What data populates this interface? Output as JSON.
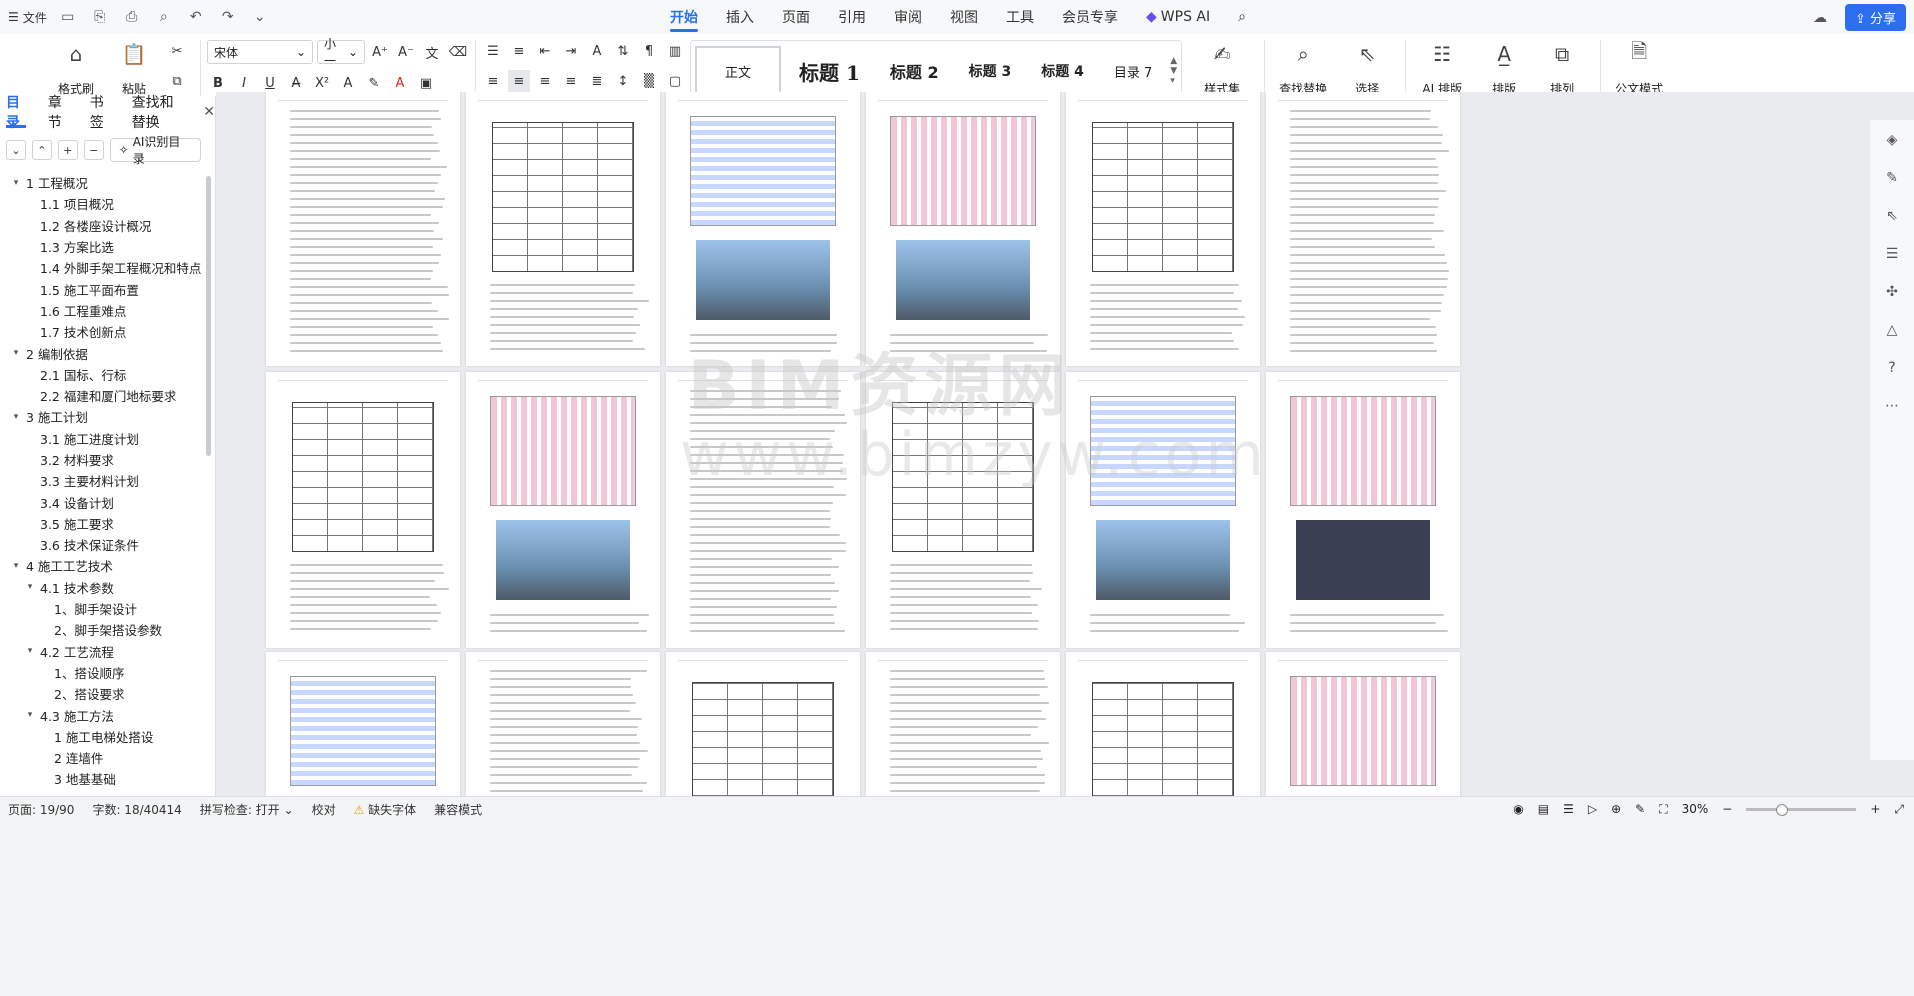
{
  "titlebar": {
    "file_menu": "文件",
    "tabs": [
      "开始",
      "插入",
      "页面",
      "引用",
      "审阅",
      "视图",
      "工具",
      "会员专享",
      "WPS AI"
    ],
    "share": "分享"
  },
  "ribbon": {
    "format_brush": "格式刷",
    "paste": "粘贴",
    "font_name": "宋体",
    "font_size": "小一",
    "styles": [
      "正文",
      "标题 1",
      "标题 2",
      "标题 3",
      "标题 4",
      "目录 7"
    ],
    "style_set": "样式集",
    "find_replace": "查找替换",
    "select": "选择",
    "ai_layout": "AI 排版",
    "layout": "排版",
    "arrange": "排列",
    "formula_mode": "公文模式"
  },
  "sidepanel": {
    "tabs": [
      "目录",
      "章节",
      "书签",
      "查找和替换"
    ],
    "ai_toc": "AI识别目录",
    "toc": [
      {
        "level": 0,
        "text": "1  工程概况",
        "collapsible": true
      },
      {
        "level": 1,
        "text": "1.1 项目概况"
      },
      {
        "level": 1,
        "text": "1.2 各楼座设计概况"
      },
      {
        "level": 1,
        "text": "1.3 方案比选"
      },
      {
        "level": 1,
        "text": "1.4 外脚手架工程概况和特点"
      },
      {
        "level": 1,
        "text": "1.5 施工平面布置"
      },
      {
        "level": 1,
        "text": "1.6 工程重难点"
      },
      {
        "level": 1,
        "text": "1.7 技术创新点"
      },
      {
        "level": 0,
        "text": "2  编制依据",
        "collapsible": true
      },
      {
        "level": 1,
        "text": "2.1 国标、行标"
      },
      {
        "level": 1,
        "text": "2.2 福建和厦门地标要求"
      },
      {
        "level": 0,
        "text": "3  施工计划",
        "collapsible": true
      },
      {
        "level": 1,
        "text": "3.1 施工进度计划"
      },
      {
        "level": 1,
        "text": "3.2 材料要求"
      },
      {
        "level": 1,
        "text": "3.3 主要材料计划"
      },
      {
        "level": 1,
        "text": "3.4 设备计划"
      },
      {
        "level": 1,
        "text": "3.5 施工要求"
      },
      {
        "level": 1,
        "text": "3.6 技术保证条件"
      },
      {
        "level": 0,
        "text": "4  施工工艺技术",
        "collapsible": true
      },
      {
        "level": 1,
        "text": "4.1 技术参数",
        "collapsible": true
      },
      {
        "level": 2,
        "text": "1、脚手架设计"
      },
      {
        "level": 2,
        "text": "2、脚手架搭设参数"
      },
      {
        "level": 1,
        "text": "4.2 工艺流程",
        "collapsible": true
      },
      {
        "level": 2,
        "text": "1、搭设顺序"
      },
      {
        "level": 2,
        "text": "2、搭设要求"
      },
      {
        "level": 1,
        "text": "4.3 施工方法",
        "collapsible": true
      },
      {
        "level": 2,
        "text": "1 施工电梯处搭设"
      },
      {
        "level": 2,
        "text": "2 连墙件"
      },
      {
        "level": 2,
        "text": "3 地基基础"
      }
    ]
  },
  "statusbar": {
    "page": "页面: 19/90",
    "words": "字数: 18/40414",
    "spell": "拼写检查: 打开",
    "proof": "校对",
    "missing_font": "缺失字体",
    "compat": "兼容模式",
    "zoom": "30%"
  },
  "watermark": {
    "line1": "BIM资源网",
    "line2": "www.bimzyw.com"
  }
}
